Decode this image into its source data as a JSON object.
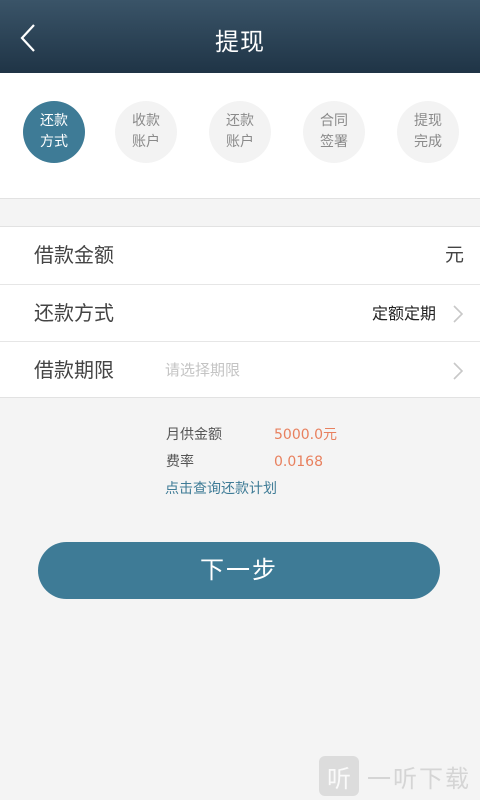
{
  "header": {
    "title": "提现",
    "back_icon": "chevron-left-icon"
  },
  "steps": [
    {
      "line1": "还款",
      "line2": "方式",
      "active": true
    },
    {
      "line1": "收款",
      "line2": "账户",
      "active": false
    },
    {
      "line1": "还款",
      "line2": "账户",
      "active": false
    },
    {
      "line1": "合同",
      "line2": "签署",
      "active": false
    },
    {
      "line1": "提现",
      "line2": "完成",
      "active": false
    }
  ],
  "form": {
    "amount": {
      "label": "借款金额",
      "unit": "元"
    },
    "repay_method": {
      "label": "还款方式",
      "value": "定额定期"
    },
    "term": {
      "label": "借款期限",
      "placeholder": "请选择期限"
    }
  },
  "info": {
    "monthly_label": "月供金额",
    "monthly_value": "5000.0元",
    "rate_label": "费率",
    "rate_value": "0.0168",
    "plan_link": "点击查询还款计划"
  },
  "next_button": "下一步",
  "watermark": {
    "logo_glyph": "听",
    "text": "一听下载"
  },
  "colors": {
    "accent": "#3e7b96",
    "header": "#2a4256",
    "highlight": "#e8805e"
  }
}
